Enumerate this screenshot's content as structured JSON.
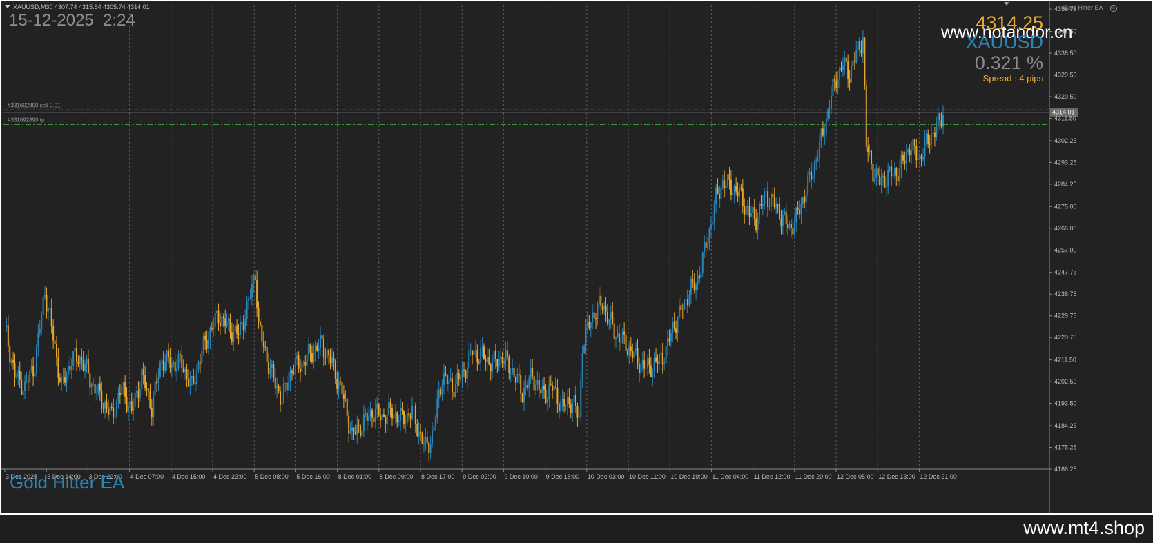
{
  "window": {
    "symbol_info": "XAUUSD,M30  4307.74 4315.84 4305.74 4314.01",
    "ea_name_top": "Gold Hitter EA",
    "menu_icon": "triangle-down-icon",
    "smile_icon": "smiley-icon"
  },
  "overlay": {
    "datetime": "15-12-2025  2:24",
    "price": "4314.25",
    "watermark_top": "www.notandor.cn",
    "symbol": "XAUUSD",
    "change": "0.321 %",
    "spread": "Spread : 4 pips",
    "ea_label": "Gold Hitter EA",
    "footer_site": "www.mt4.shop"
  },
  "colors": {
    "background": "#222222",
    "bull": "#2a86b8",
    "bear": "#e8a72f",
    "grid": "#5a5a5a",
    "sell_line": "#c85a4a",
    "tp_line": "#3fbf3f",
    "price_text": "#e8a72f",
    "symbol_text": "#2a86b8",
    "change_text": "#8a8a8a",
    "ea_text": "#2a86b8"
  },
  "chart_data": {
    "type": "candlestick",
    "symbol": "XAUUSD",
    "timeframe": "M30",
    "ylim": [
      4166.25,
      4358.5
    ],
    "y_ticks": [
      "4356.75",
      "4347.50",
      "4338.50",
      "4329.50",
      "4320.50",
      "4311.50",
      "4302.25",
      "4293.25",
      "4284.25",
      "4275.00",
      "4266.00",
      "4257.00",
      "4247.75",
      "4238.75",
      "4229.75",
      "4220.75",
      "4211.50",
      "4202.50",
      "4193.50",
      "4184.25",
      "4175.25",
      "4166.25"
    ],
    "x_ticks": [
      "3 Dec 2025",
      "3 Dec 14:00",
      "3 Dec 22:00",
      "4 Dec 07:00",
      "4 Dec 15:00",
      "4 Dec 23:00",
      "5 Dec 08:00",
      "5 Dec 16:00",
      "8 Dec 01:00",
      "8 Dec 09:00",
      "8 Dec 17:00",
      "9 Dec 02:00",
      "9 Dec 10:00",
      "9 Dec 18:00",
      "10 Dec 03:00",
      "10 Dec 11:00",
      "10 Dec 19:00",
      "11 Dec 04:00",
      "11 Dec 12:00",
      "11 Dec 20:00",
      "12 Dec 05:00",
      "12 Dec 13:00",
      "12 Dec 21:00"
    ],
    "current_price": "4314.01",
    "levels": [
      {
        "label": "#331692890 sell 0.01",
        "price": 4315.0,
        "color": "#c85a4a",
        "style": "dashed"
      },
      {
        "label": "#331692890 tp",
        "price": 4309.0,
        "color": "#3fbf3f",
        "style": "dashdot"
      }
    ],
    "price_path": [
      [
        0,
        4225
      ],
      [
        6,
        4205
      ],
      [
        12,
        4200
      ],
      [
        18,
        4210
      ],
      [
        24,
        4240
      ],
      [
        28,
        4225
      ],
      [
        34,
        4200
      ],
      [
        40,
        4212
      ],
      [
        46,
        4212
      ],
      [
        52,
        4202
      ],
      [
        58,
        4195
      ],
      [
        64,
        4188
      ],
      [
        70,
        4200
      ],
      [
        76,
        4190
      ],
      [
        82,
        4205
      ],
      [
        88,
        4192
      ],
      [
        94,
        4212
      ],
      [
        100,
        4210
      ],
      [
        106,
        4210
      ],
      [
        112,
        4200
      ],
      [
        118,
        4215
      ],
      [
        124,
        4225
      ],
      [
        128,
        4230
      ],
      [
        134,
        4225
      ],
      [
        140,
        4222
      ],
      [
        146,
        4235
      ],
      [
        150,
        4248
      ],
      [
        152,
        4225
      ],
      [
        156,
        4215
      ],
      [
        160,
        4205
      ],
      [
        166,
        4195
      ],
      [
        172,
        4208
      ],
      [
        178,
        4210
      ],
      [
        184,
        4215
      ],
      [
        190,
        4218
      ],
      [
        196,
        4210
      ],
      [
        202,
        4198
      ],
      [
        208,
        4180
      ],
      [
        214,
        4185
      ],
      [
        220,
        4190
      ],
      [
        226,
        4188
      ],
      [
        232,
        4190
      ],
      [
        238,
        4187
      ],
      [
        244,
        4190
      ],
      [
        248,
        4182
      ],
      [
        252,
        4175
      ],
      [
        256,
        4180
      ],
      [
        262,
        4205
      ],
      [
        268,
        4200
      ],
      [
        274,
        4205
      ],
      [
        280,
        4215
      ],
      [
        286,
        4213
      ],
      [
        292,
        4210
      ],
      [
        298,
        4213
      ],
      [
        304,
        4207
      ],
      [
        310,
        4198
      ],
      [
        316,
        4205
      ],
      [
        322,
        4197
      ],
      [
        328,
        4200
      ],
      [
        334,
        4192
      ],
      [
        340,
        4195
      ],
      [
        344,
        4187
      ],
      [
        346,
        4218
      ],
      [
        352,
        4230
      ],
      [
        358,
        4235
      ],
      [
        362,
        4228
      ],
      [
        366,
        4222
      ],
      [
        372,
        4218
      ],
      [
        378,
        4212
      ],
      [
        384,
        4208
      ],
      [
        390,
        4210
      ],
      [
        396,
        4215
      ],
      [
        400,
        4225
      ],
      [
        404,
        4230
      ],
      [
        410,
        4240
      ],
      [
        414,
        4243
      ],
      [
        418,
        4253
      ],
      [
        422,
        4265
      ],
      [
        426,
        4278
      ],
      [
        430,
        4285
      ],
      [
        436,
        4283
      ],
      [
        440,
        4280
      ],
      [
        446,
        4272
      ],
      [
        450,
        4270
      ],
      [
        456,
        4280
      ],
      [
        462,
        4275
      ],
      [
        466,
        4270
      ],
      [
        470,
        4266
      ],
      [
        474,
        4270
      ],
      [
        478,
        4278
      ],
      [
        484,
        4290
      ],
      [
        490,
        4305
      ],
      [
        494,
        4318
      ],
      [
        498,
        4328
      ],
      [
        502,
        4334
      ],
      [
        506,
        4330
      ],
      [
        510,
        4338
      ],
      [
        514,
        4345
      ],
      [
        516,
        4300
      ],
      [
        520,
        4290
      ],
      [
        524,
        4285
      ],
      [
        530,
        4288
      ],
      [
        536,
        4290
      ],
      [
        542,
        4300
      ],
      [
        548,
        4295
      ],
      [
        554,
        4304
      ],
      [
        558,
        4307
      ],
      [
        562,
        4314
      ]
    ]
  }
}
